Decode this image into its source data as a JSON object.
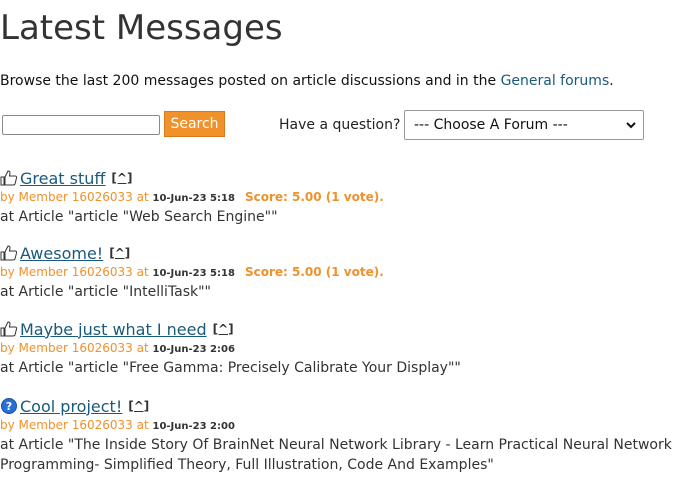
{
  "page": {
    "title": "Latest Messages",
    "intro_text": "Browse the last 200 messages posted on article discussions and in the ",
    "intro_link": "General forums",
    "intro_end": "."
  },
  "search": {
    "value": "",
    "button_label": "Search"
  },
  "question": {
    "label": "Have a question?",
    "select_value": "--- Choose A Forum ---"
  },
  "messages": [
    {
      "icon": "thumbs-up-icon",
      "title": "Great stuff",
      "caret": "[^]",
      "by": "by Member 16026033 at ",
      "date": "10-Jun-23 5:18",
      "score": "Score: 5.00 (1 vote).",
      "where": "at Article \"article \"Web Search Engine\"\""
    },
    {
      "icon": "thumbs-up-icon",
      "title": "Awesome!",
      "caret": "[^]",
      "by": "by Member 16026033 at ",
      "date": "10-Jun-23 5:18",
      "score": "Score: 5.00 (1 vote).",
      "where": "at Article \"article \"IntelliTask\"\""
    },
    {
      "icon": "thumbs-up-icon",
      "title": "Maybe just what I need",
      "caret": "[^]",
      "by": "by Member 16026033 at ",
      "date": "10-Jun-23 2:06",
      "score": "",
      "where": "at Article \"article \"Free Gamma: Precisely Calibrate Your Display\"\""
    },
    {
      "icon": "question-icon",
      "title": "Cool project!",
      "caret": "[^]",
      "by": "by Member 16026033 at ",
      "date": "10-Jun-23 2:00",
      "score": "",
      "where": "at Article \"The Inside Story Of BrainNet Neural Network Library - Learn Practical Neural Network Programming- Simplified Theory, Full Illustration, Code And Examples\""
    }
  ],
  "colors": {
    "accent": "#f0912a",
    "link": "#1a5a7a",
    "text": "#333333"
  }
}
